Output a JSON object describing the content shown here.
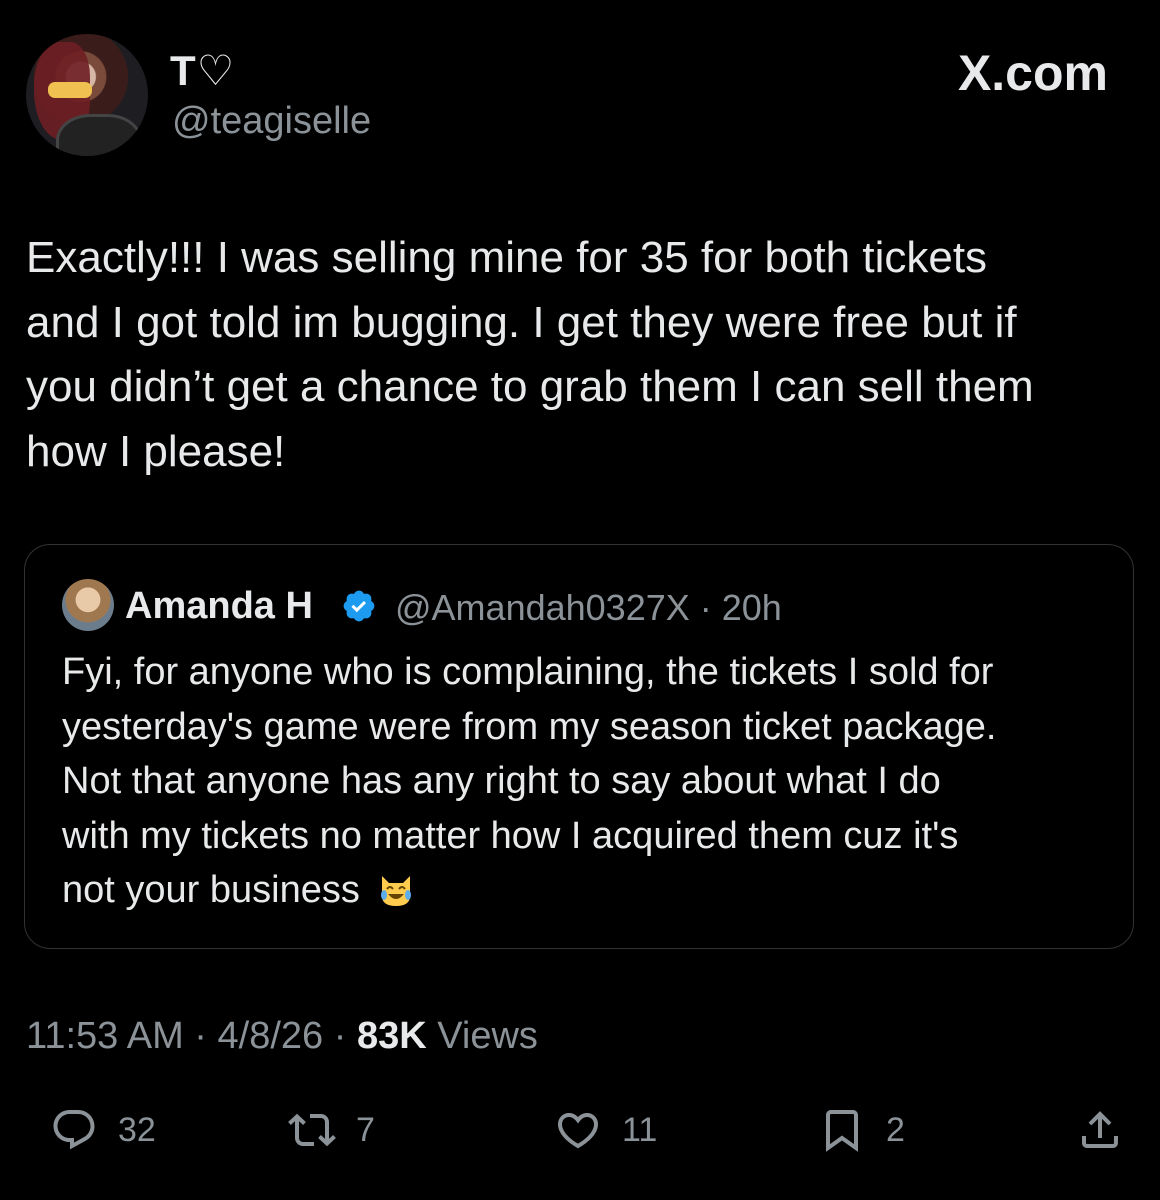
{
  "author": {
    "display_name": "T♡",
    "handle": "@teagiselle"
  },
  "brand": "X.com",
  "tweet": {
    "lines": [
      "Exactly!!! I was selling mine for 35 for both tickets",
      "and I got told im bugging. I get they were free but if",
      "you didn’t get a chance to grab them I can sell them",
      "how I please!"
    ]
  },
  "quote": {
    "name": "Amanda H",
    "handle_time": "@Amandah0327X · 20h",
    "lines": [
      "Fyi, for anyone who is complaining, the tickets I sold for",
      "yesterday's game were from my season ticket package.",
      "Not that anyone has any right to say about what I do",
      "with my tickets no matter how I acquired them cuz it's",
      "not your business"
    ],
    "emoji": "laughing-crying-cat-emoji"
  },
  "meta": {
    "time_date": "11:53 AM · 4/8/26 · ",
    "views_count": "83K",
    "views_label": " Views"
  },
  "actions": {
    "replies": "32",
    "reposts": "7",
    "likes": "11",
    "bookmarks": "2"
  },
  "colors": {
    "background": "#000000",
    "text": "#e7e9ea",
    "muted": "#8b9298",
    "verified": "#1d9bf0",
    "border": "#2f3336"
  }
}
